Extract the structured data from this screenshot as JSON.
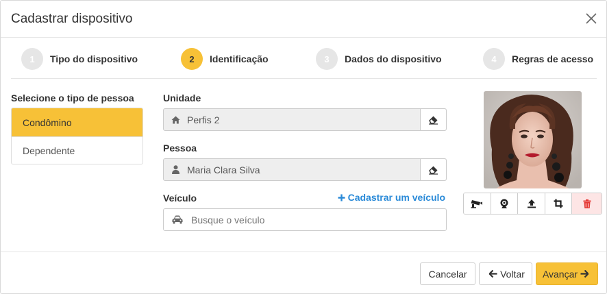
{
  "modal": {
    "title": "Cadastrar dispositivo"
  },
  "stepper": {
    "steps": [
      {
        "number": "1",
        "label": "Tipo do dispositivo",
        "active": false
      },
      {
        "number": "2",
        "label": "Identificação",
        "active": true
      },
      {
        "number": "3",
        "label": "Dados do dispositivo",
        "active": false
      },
      {
        "number": "4",
        "label": "Regras de acesso",
        "active": false
      }
    ]
  },
  "person_type": {
    "label": "Selecione o tipo de pessoa",
    "options": [
      {
        "label": "Condômino",
        "selected": true
      },
      {
        "label": "Dependente",
        "selected": false
      }
    ]
  },
  "unit": {
    "label": "Unidade",
    "value": "Perfis 2",
    "icon": "home-icon"
  },
  "person": {
    "label": "Pessoa",
    "value": "Maria Clara Silva",
    "icon": "user-icon"
  },
  "vehicle": {
    "label": "Veículo",
    "add_link": "Cadastrar um veículo",
    "placeholder": "Busque o veículo",
    "icon": "car-icon"
  },
  "photo_toolbar": {
    "buttons": [
      "camera-icon",
      "webcam-icon",
      "upload-icon",
      "crop-icon",
      "trash-icon"
    ]
  },
  "footer": {
    "cancel": "Cancelar",
    "back": "Voltar",
    "next": "Avançar"
  },
  "colors": {
    "accent": "#f7c137",
    "link": "#2a8ad8",
    "danger": "#e53935",
    "danger_bg": "#fde5e5"
  }
}
